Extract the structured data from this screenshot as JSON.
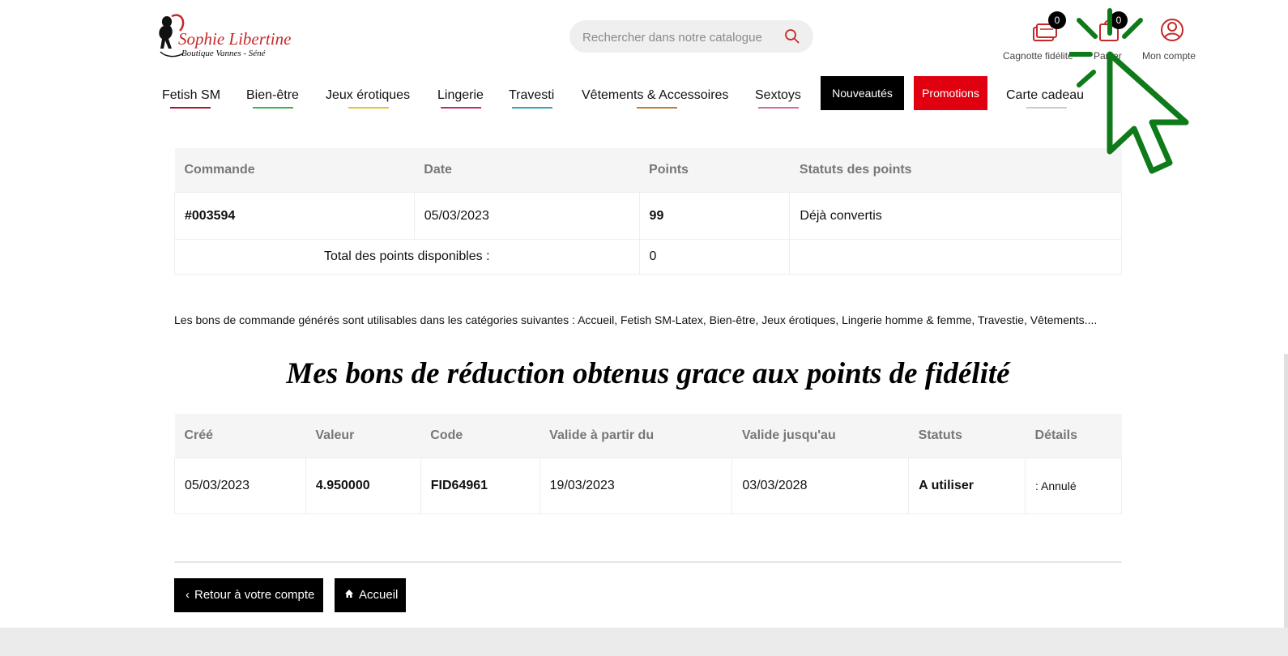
{
  "header": {
    "logo": {
      "brand": "Sophie Libertine",
      "tagline": "Boutique Vannes - Séné"
    },
    "search": {
      "placeholder": "Rechercher dans notre catalogue"
    },
    "icons": [
      {
        "name": "loyalty-jar",
        "label": "Cagnotte fidélité",
        "badge": "0"
      },
      {
        "name": "cart",
        "label": "Panier",
        "badge": "0"
      },
      {
        "name": "account",
        "label": "Mon compte"
      }
    ]
  },
  "nav": {
    "items": [
      {
        "label": "Fetish SM",
        "color": "#b3122d"
      },
      {
        "label": "Bien-être",
        "color": "#39b54a"
      },
      {
        "label": "Jeux érotiques",
        "color": "#e8c51a"
      },
      {
        "label": "Lingerie",
        "color": "#c2287a"
      },
      {
        "label": "Travesti",
        "color": "#2aa7c4"
      },
      {
        "label": "Vêtements & Accessoires",
        "color": "#c97a2a"
      },
      {
        "label": "Sextoys",
        "color": "#d9669c"
      },
      {
        "label": "Nouveautés",
        "color": "#000000"
      },
      {
        "label": "Promotions",
        "color": "#e00010"
      },
      {
        "label": "Carte cadeau",
        "color": "#cccccc"
      }
    ]
  },
  "points_table": {
    "headers": [
      "Commande",
      "Date",
      "Points",
      "Statuts des points"
    ],
    "rows": [
      {
        "order": "#003594",
        "date": "05/03/2023",
        "points": "99",
        "status": "Déjà convertis"
      }
    ],
    "total_label": "Total des points disponibles :",
    "total_value": "0"
  },
  "note": "Les bons de commande générés sont utilisables dans les catégories suivantes : Accueil, Fetish SM-Latex, Bien-être, Jeux érotiques, Lingerie homme & femme, Travestie, Vêtements....",
  "vouchers": {
    "title": "Mes bons de réduction obtenus grace aux points de fidélité",
    "headers": [
      "Créé",
      "Valeur",
      "Code",
      "Valide à partir du",
      "Valide jusqu'au",
      "Statuts",
      "Détails"
    ],
    "rows": [
      {
        "created": "05/03/2023",
        "value": "4.950000",
        "code": "FID64961",
        "valid_from": "19/03/2023",
        "valid_to": "03/03/2028",
        "status": "A utiliser",
        "details": ": Annulé"
      }
    ]
  },
  "actions": {
    "back_label": "Retour à votre compte",
    "home_label": "Accueil"
  },
  "colors": {
    "accent": "#c62828",
    "cursor": "#0e7a1a"
  }
}
